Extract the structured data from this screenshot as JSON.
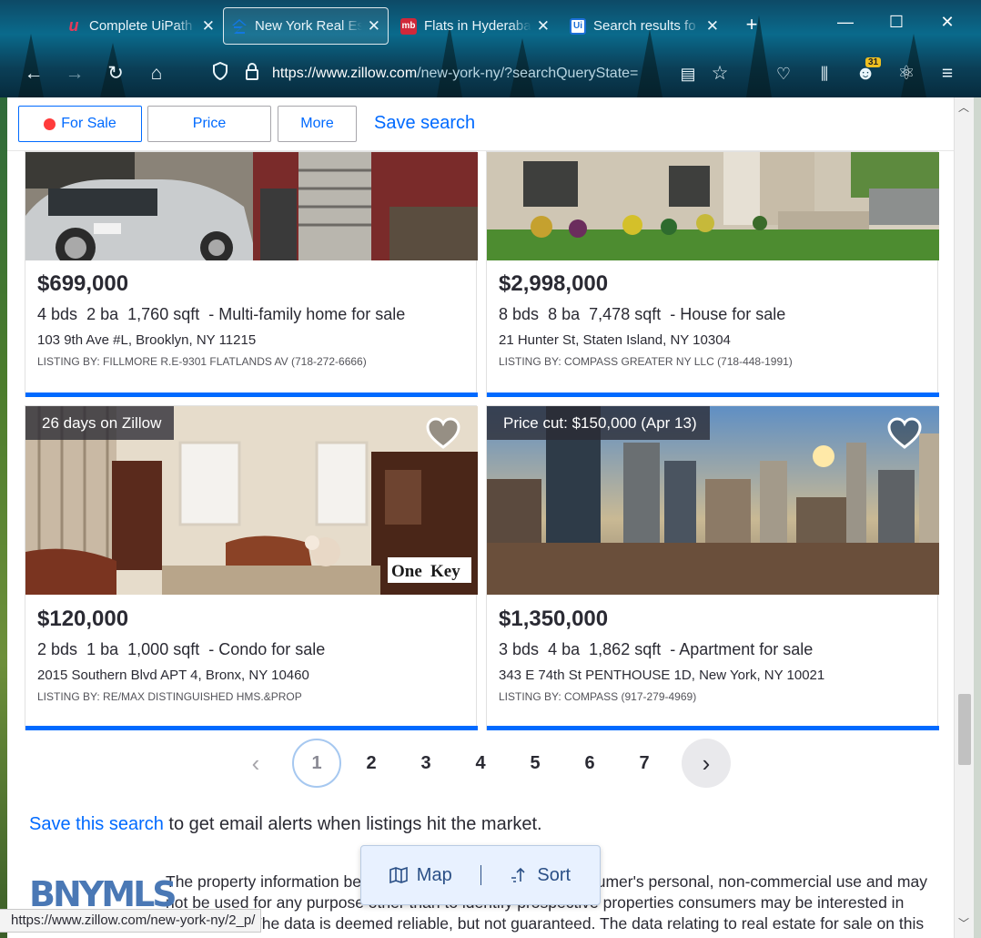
{
  "browser": {
    "tabs": [
      {
        "title": "Complete UiPath",
        "favicon": "uipath-academy-icon",
        "color": "#e23b5b",
        "active": false
      },
      {
        "title": "New York Real Est",
        "favicon": "zillow-icon",
        "color": "#1277e1",
        "active": true
      },
      {
        "title": "Flats in Hyderaba",
        "favicon": "magicbricks-icon",
        "color": "#d0283a",
        "active": false
      },
      {
        "title": "Search results fo",
        "favicon": "uipath-icon",
        "color": "#1b6fd8",
        "active": false
      }
    ],
    "url_host": "https://www.zillow.com",
    "url_path": "/new-york-ny/?searchQueryState=",
    "badge_count": "31",
    "status_url": "https://www.zillow.com/new-york-ny/2_p/"
  },
  "filters": {
    "for_sale": "For Sale",
    "price": "Price",
    "more": "More",
    "save_search": "Save search"
  },
  "listings": [
    {
      "price": "$699,000",
      "beds": "4",
      "beds_unit": "bds",
      "baths": "2",
      "baths_unit": "ba",
      "sqft": "1,760",
      "sqft_unit": "sqft",
      "type": "- Multi-family home for sale",
      "address": "103 9th Ave #L, Brooklyn, NY 11215",
      "listing_by": "LISTING BY: FILLMORE R.E-9301 FLATLANDS AV (718-272-6666)"
    },
    {
      "price": "$2,998,000",
      "beds": "8",
      "beds_unit": "bds",
      "baths": "8",
      "baths_unit": "ba",
      "sqft": "7,478",
      "sqft_unit": "sqft",
      "type": "- House for sale",
      "address": "21 Hunter St, Staten Island, NY 10304",
      "listing_by": "LISTING BY: COMPASS GREATER NY LLC (718-448-1991)"
    },
    {
      "flag": "26 days on Zillow",
      "logo": "OneKey",
      "price": "$120,000",
      "beds": "2",
      "beds_unit": "bds",
      "baths": "1",
      "baths_unit": "ba",
      "sqft": "1,000",
      "sqft_unit": "sqft",
      "type": "- Condo for sale",
      "address": "2015 Southern Blvd APT 4, Bronx, NY 10460",
      "listing_by": "LISTING BY: RE/MAX DISTINGUISHED HMS.&PROP"
    },
    {
      "flag": "Price cut: $150,000 (Apr 13)",
      "price": "$1,350,000",
      "beds": "3",
      "beds_unit": "bds",
      "baths": "4",
      "baths_unit": "ba",
      "sqft": "1,862",
      "sqft_unit": "sqft",
      "type": "- Apartment for sale",
      "address": "343 E 74th St PENTHOUSE 1D, New York, NY 10021",
      "listing_by": "LISTING BY: COMPASS (917-279-4969)"
    }
  ],
  "pagination": {
    "pages": [
      "1",
      "2",
      "3",
      "4",
      "5",
      "6",
      "7"
    ],
    "current": "1",
    "prev": "‹",
    "next": "›"
  },
  "alerts": {
    "link": "Save this search",
    "rest": " to get email alerts when listings hit the market."
  },
  "disclaimer": {
    "logo": "BNYMLS",
    "text": "The property information being provided is solely for the consumer's personal, non-commercial use and may not be used for any purpose other than to identify prospective properties consumers may be interested in purchasing. The data is deemed reliable, but not guaranteed. The data relating to real estate for sale on this web site comes in part"
  },
  "floating": {
    "map": "Map",
    "sort": "Sort"
  },
  "colors": {
    "accent": "#006aff",
    "text": "#2a2a33"
  }
}
